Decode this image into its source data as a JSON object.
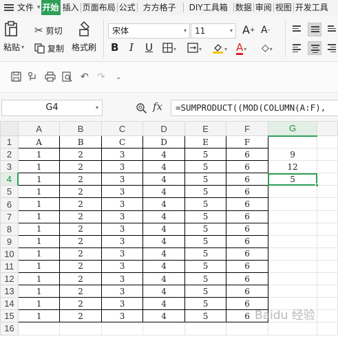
{
  "menu": {
    "file": "文件",
    "tabs": [
      "开始",
      "插入",
      "页面布局",
      "公式",
      "方方格子",
      "DIY工具箱",
      "数据",
      "审阅",
      "视图",
      "开发工具"
    ]
  },
  "ribbon": {
    "paste": "粘贴",
    "cut": "剪切",
    "copy": "复制",
    "format_painter": "格式刷",
    "font_name": "宋体",
    "font_size": "11",
    "bold": "B",
    "italic": "I",
    "underline": "U",
    "font_color_letter": "A",
    "grow_font": "A",
    "shrink_font": "A",
    "accent_color": "#2f9e57",
    "font_color": "#e02020",
    "fill_color": "#f5c400"
  },
  "quick_access": [
    "save-icon",
    "share-icon",
    "print-icon",
    "print-preview-icon",
    "undo-icon",
    "redo-icon",
    "customize-icon"
  ],
  "formula_bar": {
    "name_box": "G4",
    "fx": "fx",
    "formula": "=SUMPRODUCT((MOD(COLUMN(A:F),"
  },
  "sheet": {
    "columns": [
      "A",
      "B",
      "C",
      "D",
      "E",
      "F",
      "G"
    ],
    "rows": [
      {
        "n": "1",
        "cells": [
          "A",
          "B",
          "C",
          "D",
          "E",
          "F",
          ""
        ]
      },
      {
        "n": "2",
        "cells": [
          "1",
          "2",
          "3",
          "4",
          "5",
          "6",
          "9"
        ]
      },
      {
        "n": "3",
        "cells": [
          "1",
          "2",
          "3",
          "4",
          "5",
          "6",
          "12"
        ]
      },
      {
        "n": "4",
        "cells": [
          "1",
          "2",
          "3",
          "4",
          "5",
          "6",
          "5"
        ]
      },
      {
        "n": "5",
        "cells": [
          "1",
          "2",
          "3",
          "4",
          "5",
          "6",
          ""
        ]
      },
      {
        "n": "6",
        "cells": [
          "1",
          "2",
          "3",
          "4",
          "5",
          "6",
          ""
        ]
      },
      {
        "n": "7",
        "cells": [
          "1",
          "2",
          "3",
          "4",
          "5",
          "6",
          ""
        ]
      },
      {
        "n": "8",
        "cells": [
          "1",
          "2",
          "3",
          "4",
          "5",
          "6",
          ""
        ]
      },
      {
        "n": "9",
        "cells": [
          "1",
          "2",
          "3",
          "4",
          "5",
          "6",
          ""
        ]
      },
      {
        "n": "10",
        "cells": [
          "1",
          "2",
          "3",
          "4",
          "5",
          "6",
          ""
        ]
      },
      {
        "n": "11",
        "cells": [
          "1",
          "2",
          "3",
          "4",
          "5",
          "6",
          ""
        ]
      },
      {
        "n": "12",
        "cells": [
          "1",
          "2",
          "3",
          "4",
          "5",
          "6",
          ""
        ]
      },
      {
        "n": "13",
        "cells": [
          "1",
          "2",
          "3",
          "4",
          "5",
          "6",
          ""
        ]
      },
      {
        "n": "14",
        "cells": [
          "1",
          "2",
          "3",
          "4",
          "5",
          "6",
          ""
        ]
      },
      {
        "n": "15",
        "cells": [
          "1",
          "2",
          "3",
          "4",
          "5",
          "6",
          ""
        ]
      },
      {
        "n": "16",
        "cells": [
          "",
          "",
          "",
          "",
          "",
          "",
          ""
        ]
      }
    ],
    "active_cell": "G4"
  },
  "watermark": "Baidu 经验"
}
